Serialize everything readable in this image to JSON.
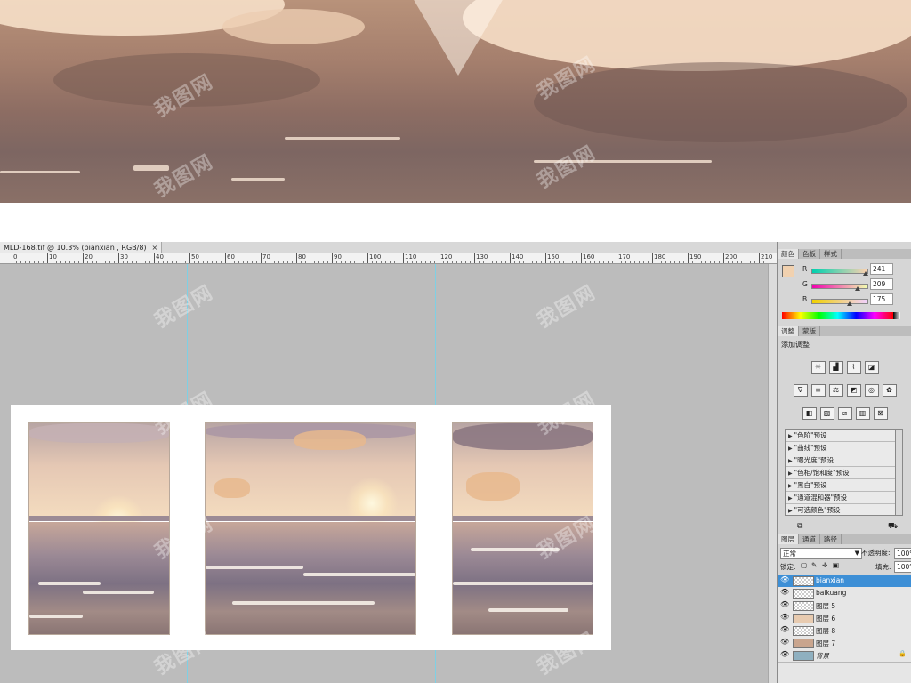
{
  "document": {
    "tab_title": "MLD-168.tif @ 10.3% (bianxian , RGB/8)",
    "close_glyph": "×"
  },
  "ruler": {
    "labels": [
      "0",
      "10",
      "20",
      "30",
      "40",
      "50",
      "60",
      "70",
      "80",
      "90",
      "100",
      "110",
      "120",
      "130",
      "140",
      "150",
      "160",
      "170",
      "180",
      "190",
      "200",
      "210"
    ]
  },
  "color_panel": {
    "tabs": [
      "颜色",
      "色板",
      "样式"
    ],
    "foreground_color": "#f1d1af",
    "channels": [
      {
        "label": "R",
        "value": "241"
      },
      {
        "label": "G",
        "value": "209"
      },
      {
        "label": "B",
        "value": "175"
      }
    ]
  },
  "adjustments_panel": {
    "tabs": [
      "调整",
      "蒙版"
    ],
    "title": "添加调整",
    "icon_rows": [
      [
        "brightness-contrast-icon",
        "levels-icon",
        "curves-icon",
        "exposure-icon"
      ],
      [
        "vibrance-icon",
        "hue-saturation-icon",
        "color-balance-icon",
        "black-white-icon",
        "photo-filter-icon",
        "channel-mixer-icon"
      ],
      [
        "invert-icon",
        "posterize-icon",
        "threshold-icon",
        "gradient-map-icon",
        "selective-color-icon"
      ]
    ],
    "presets": [
      "\"色阶\"预设",
      "\"曲线\"预设",
      "\"曝光度\"预设",
      "\"色相/饱和度\"预设",
      "\"黑白\"预设",
      "\"通道混和器\"预设",
      "\"可选颜色\"预设"
    ]
  },
  "layers_panel": {
    "tabs": [
      "图层",
      "通道",
      "路径"
    ],
    "blend_mode": "正常",
    "opacity_label": "不透明度:",
    "opacity_value": "100%",
    "lock_label": "锁定:",
    "fill_label": "填充:",
    "fill_value": "100%",
    "layers": [
      {
        "name": "bianxian",
        "selected": true
      },
      {
        "name": "baikuang",
        "selected": false
      },
      {
        "name": "图层 5",
        "selected": false
      },
      {
        "name": "图层 6",
        "selected": false
      },
      {
        "name": "图层 8",
        "selected": false
      },
      {
        "name": "图层 7",
        "selected": false
      },
      {
        "name": "背景",
        "selected": false,
        "locked": true
      }
    ]
  },
  "watermark": "我图网"
}
